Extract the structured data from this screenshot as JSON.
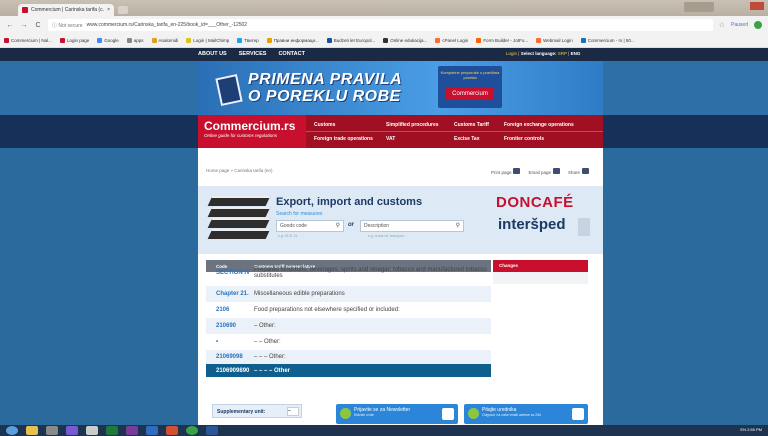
{
  "browser": {
    "tab_title": "Commercium | Carinska tarifa (c...",
    "nav_back": "←",
    "nav_forward": "→",
    "nav_reload": "C",
    "security": "ⓘ Not secure",
    "url": "www.commercium.rs/Carinska_tarifa_en-225/book_id=___Other_-12502",
    "paused": "Paused",
    "bookmarks": [
      {
        "label": "Commercium | Nal...",
        "color": "#c8102e"
      },
      {
        "label": "Login page",
        "color": "#c8102e"
      },
      {
        "label": "Google",
        "color": "#4285f4"
      },
      {
        "label": "apps",
        "color": "#888888"
      },
      {
        "label": "Analomidi",
        "color": "#e0a020"
      },
      {
        "label": "Login | MailChimp",
        "color": "#e0c020"
      },
      {
        "label": "Твитер",
        "color": "#1da1f2"
      },
      {
        "label": "Правни информаци...",
        "color": "#e8a000"
      },
      {
        "label": "Budzeti let Europol...",
        "color": "#1b4fa0"
      },
      {
        "label": "Online edukacija...",
        "color": "#333333"
      },
      {
        "label": "cPanel Login",
        "color": "#ff6c2c"
      },
      {
        "label": "Form Builder - JotFo...",
        "color": "#ff6100"
      },
      {
        "label": "Webmail Login",
        "color": "#ff6c2c"
      },
      {
        "label": "Commercium - rs | 50...",
        "color": "#1b6fb5"
      }
    ]
  },
  "site": {
    "topnav": [
      "ABOUT US",
      "SERVICES",
      "CONTACT"
    ],
    "login": "Login",
    "select_language": "Select language:",
    "lang_srp": "SRP",
    "lang_eng": "ENG",
    "banner_line1": "PRIMENA PRAVILA",
    "banner_line2": "O POREKLU ROBE",
    "eu_text": "Kompletne preporuke o pravilima porekla",
    "eu_brand": "Commercium",
    "logo_name": "Commercium.rs",
    "logo_sub": "Online guide for customs regulations",
    "menu_row1": [
      "Customs",
      "Simplified procedures",
      "Customs Tariff",
      "Foreign exchange operations"
    ],
    "menu_row2": [
      "Foreign trade operations",
      "VAT",
      "Excise Tax",
      "Frontier controls"
    ]
  },
  "page": {
    "breadcrumb": "Home page » Carinska tarifa (en)",
    "print": "Print page",
    "email": "Email page",
    "share": "Share",
    "hero_title": "Export, import and customs",
    "hero_sub": "Search for measures",
    "goods_placeholder": "Goods code",
    "or": "or",
    "desc_placeholder": "Description",
    "goods_hint": "e.g. 0101 21",
    "desc_hint": "e.g. crude oil, transport...",
    "ad1": "DONCAFÉ",
    "ad2": "interšped",
    "col1": "Code",
    "col2": "Customs tariff nomenclature",
    "changes": "Changes",
    "rows": [
      {
        "code": "SECTION IV",
        "desc": "Prepared foodstuffs; beverages, spirits and vinegar; tobacco and manufactured tobacco substitutes"
      },
      {
        "code": "Chapter 21.",
        "desc": "Miscellaneous edible preparations"
      },
      {
        "code": "2106",
        "desc": "Food preparations not elsewhere specified or included:"
      },
      {
        "code": "210690",
        "desc": "– Other:"
      },
      {
        "code": "•",
        "desc": "– – Other:"
      },
      {
        "code": "21069098",
        "desc": "– – – Other:"
      },
      {
        "code": "2106909890",
        "desc": "– – – – Other"
      }
    ],
    "supplementary_unit": "Supplementary unit:",
    "supp_value": "–"
  },
  "popups": {
    "newsletter_title": "Prijavite se za Newsletter",
    "newsletter_sub": "Kliknite ovde",
    "editor_title": "Pitajte urednika",
    "editor_sub": "Odgovor na vaše email adrese za 24h"
  },
  "taskbar": {
    "tray_lang": "EN",
    "clock": "2:55 PM"
  }
}
